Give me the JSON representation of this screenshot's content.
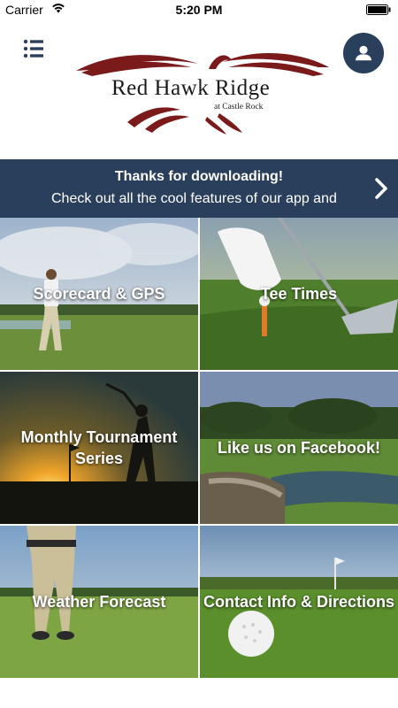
{
  "status_bar": {
    "carrier": "Carrier",
    "time": "5:20 PM",
    "wifi_icon": "wifi-icon",
    "battery_icon": "battery-icon"
  },
  "header": {
    "menu_icon": "list-menu-icon",
    "profile_icon": "user-icon",
    "logo": {
      "name": "Red Hawk Ridge",
      "subtitle": "at Castle Rock",
      "logo_color": "#7a1a1a"
    }
  },
  "banner": {
    "title": "Thanks for downloading!",
    "body": "Check out all the cool features of our app and",
    "arrow_icon": "chevron-right-icon",
    "background": "#2a3f5c"
  },
  "tiles": [
    {
      "label": "Scorecard & GPS"
    },
    {
      "label": "Tee Times"
    },
    {
      "label": "Monthly Tournament Series"
    },
    {
      "label": "Like us on Facebook!"
    },
    {
      "label": "Weather Forecast"
    },
    {
      "label": "Contact Info & Directions"
    }
  ],
  "colors": {
    "accent": "#2a3f5c",
    "text_on_image": "#ffffff"
  }
}
